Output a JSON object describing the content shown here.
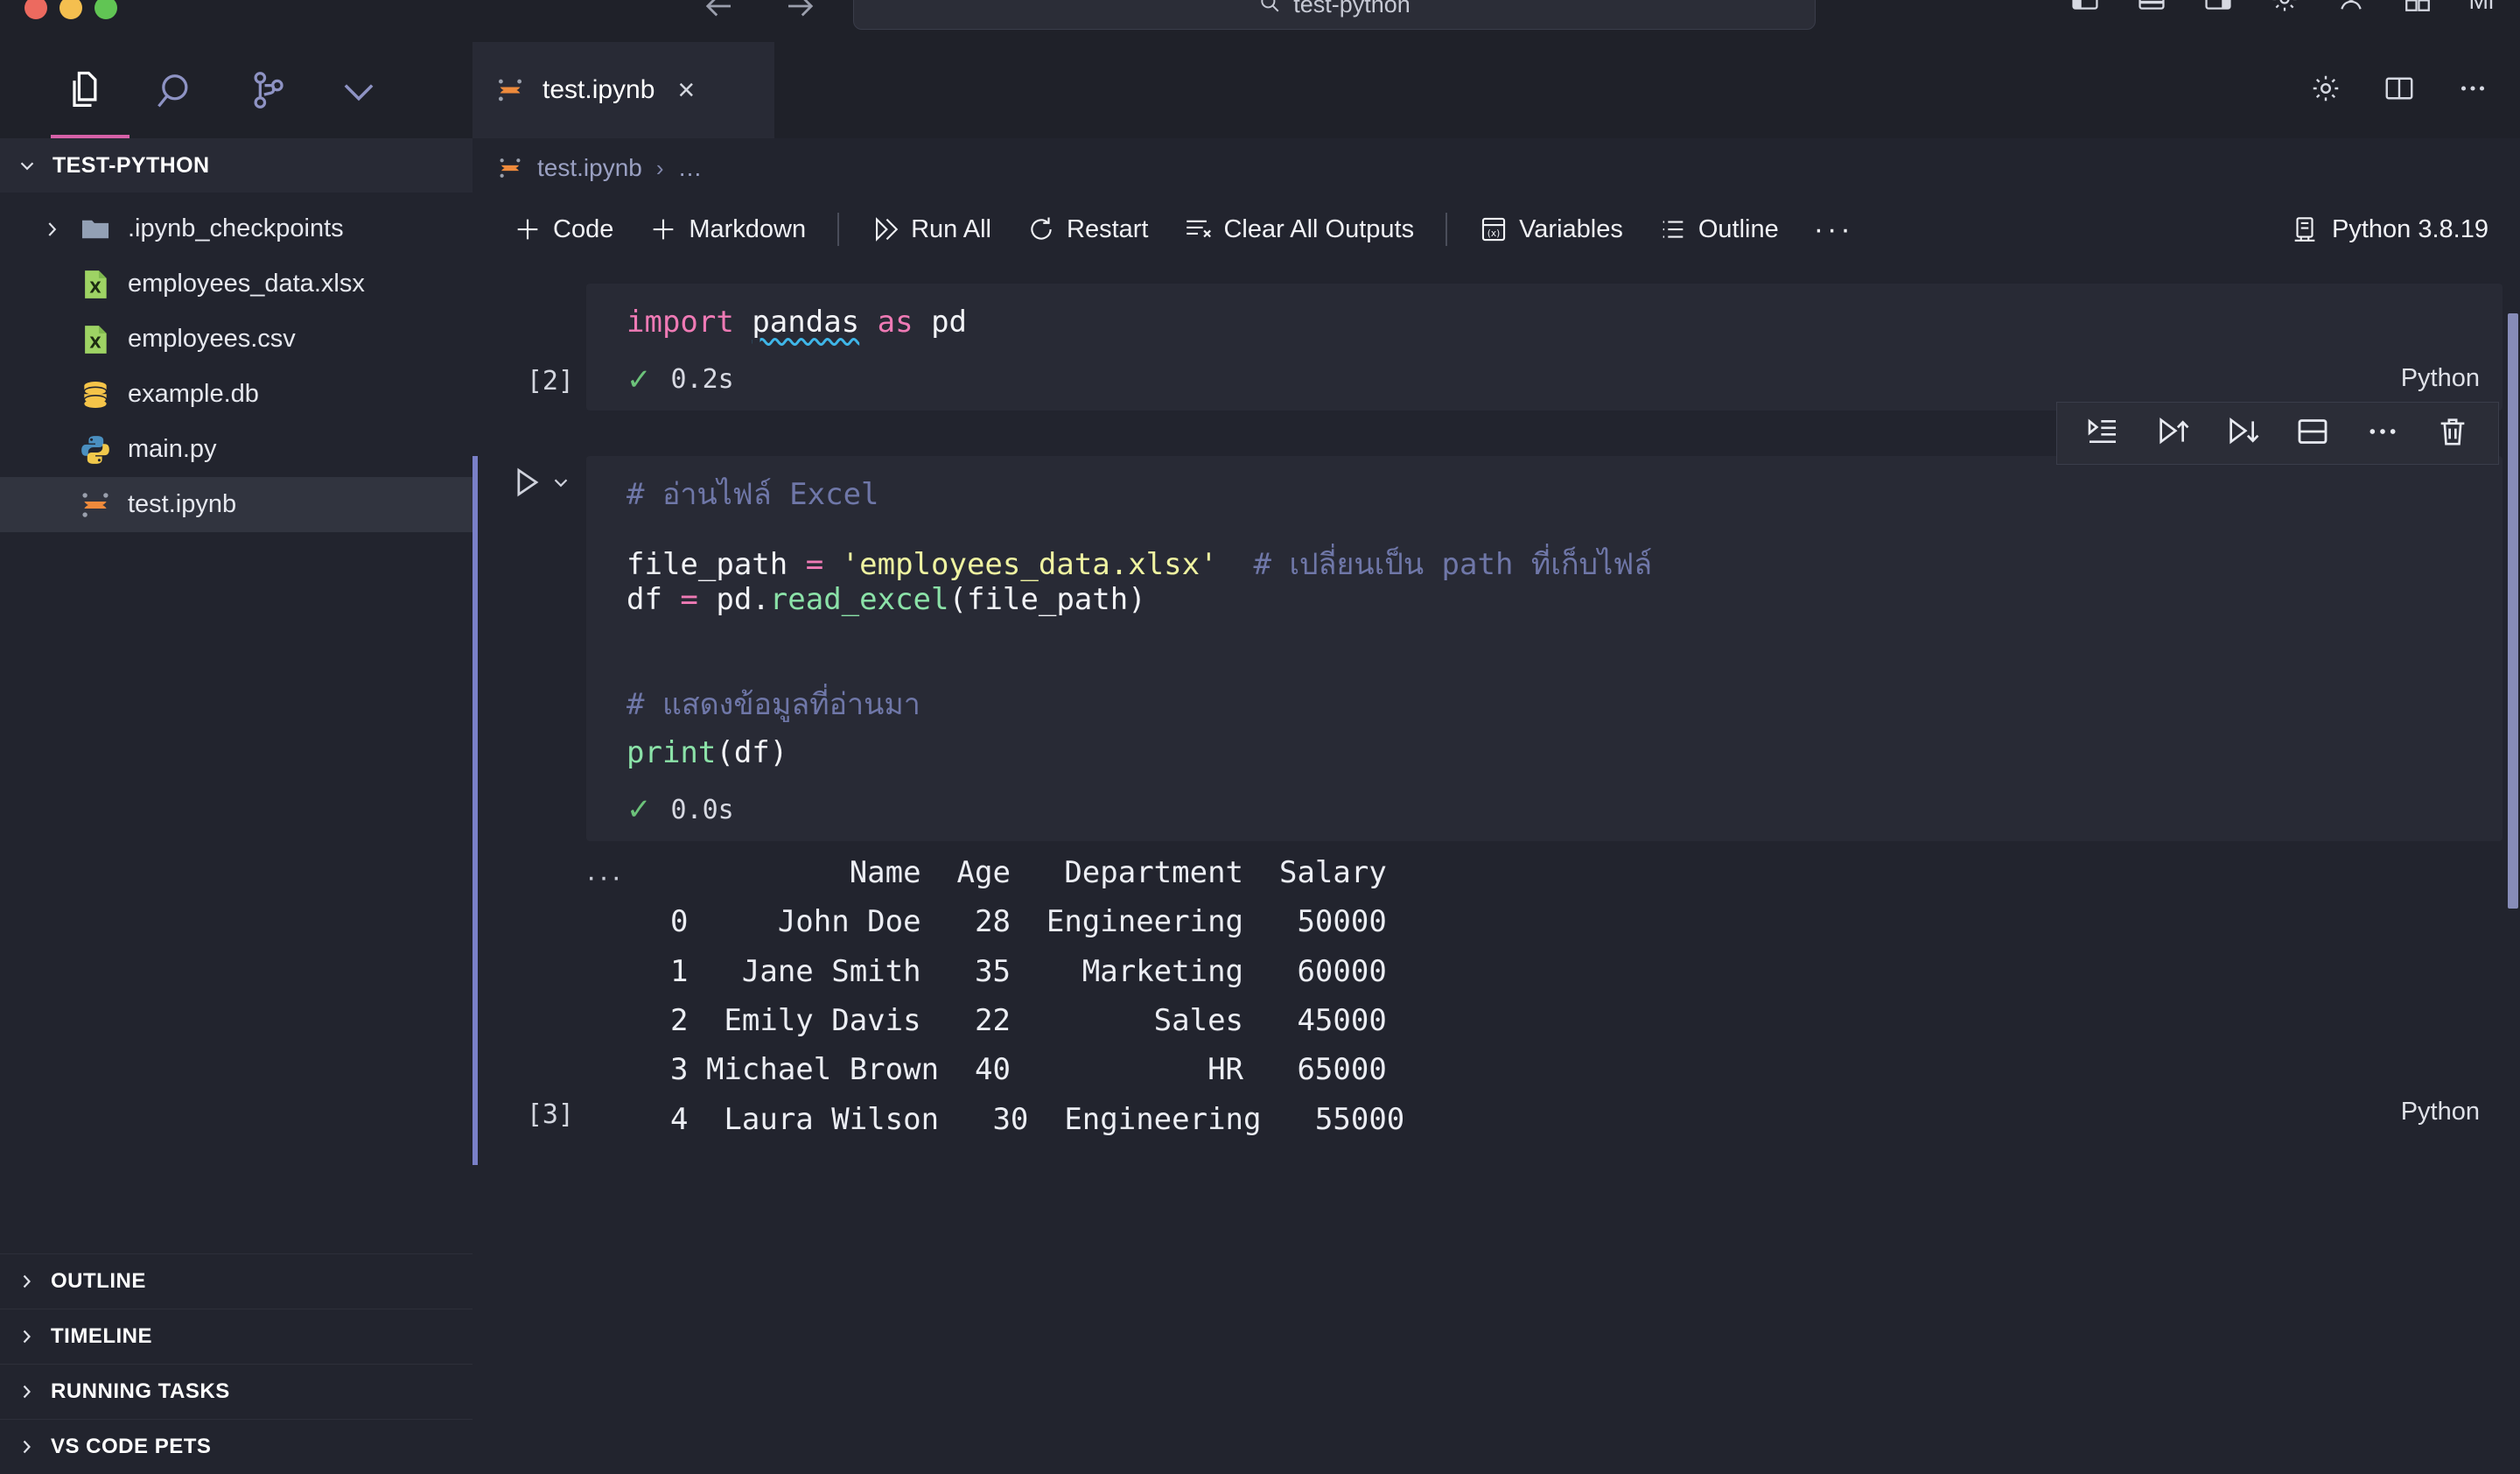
{
  "titlebar": {
    "quickopen_text": "test-python",
    "quickopen_icon": "search-icon",
    "back_icon": "arrow-left-icon",
    "forward_icon": "arrow-right-icon",
    "right_icons": [
      "layout-sidebar-left-icon",
      "layout-panel-icon",
      "layout-sidebar-right-icon",
      "gear-icon",
      "account-icon"
    ],
    "right_label": "Mi"
  },
  "activitybar": {
    "items": [
      {
        "name": "explorer-icon",
        "label": "Explorer",
        "active": true
      },
      {
        "name": "search-icon",
        "label": "Search",
        "active": false
      },
      {
        "name": "source-control-icon",
        "label": "Source Control",
        "active": false
      },
      {
        "name": "chevron-down-icon",
        "label": "More Views",
        "active": false
      }
    ]
  },
  "sidebar": {
    "header": {
      "title": "TEST-PYTHON",
      "chevron": "chevron-down-icon"
    },
    "files": [
      {
        "name": ".ipynb_checkpoints",
        "icon": "folder-icon",
        "twisty": "chevron-right-icon",
        "selected": false
      },
      {
        "name": "employees_data.xlsx",
        "icon": "excel-icon",
        "twisty": "",
        "selected": false
      },
      {
        "name": "employees.csv",
        "icon": "excel-icon",
        "twisty": "",
        "selected": false
      },
      {
        "name": "example.db",
        "icon": "database-icon",
        "twisty": "",
        "selected": false
      },
      {
        "name": "main.py",
        "icon": "python-icon",
        "twisty": "",
        "selected": false
      },
      {
        "name": "test.ipynb",
        "icon": "jupyter-icon",
        "twisty": "",
        "selected": true
      }
    ],
    "panels": [
      {
        "label": "OUTLINE",
        "chevron": "chevron-right-icon"
      },
      {
        "label": "TIMELINE",
        "chevron": "chevron-right-icon"
      },
      {
        "label": "RUNNING TASKS",
        "chevron": "chevron-right-icon"
      },
      {
        "label": "VS CODE PETS",
        "chevron": "chevron-right-icon"
      }
    ]
  },
  "editor": {
    "tab": {
      "label": "test.ipynb",
      "icon": "jupyter-icon",
      "close": "×"
    },
    "tab_actions": [
      "gear-icon",
      "split-editor-icon",
      "more-actions-icon"
    ],
    "breadcrumb": {
      "icon": "jupyter-icon",
      "file": "test.ipynb",
      "separator": "›",
      "more": "…"
    },
    "toolbar": {
      "add_code": "Code",
      "add_markdown": "Markdown",
      "run_all": "Run All",
      "restart": "Restart",
      "clear_all_outputs": "Clear All Outputs",
      "variables": "Variables",
      "outline": "Outline",
      "more": "···",
      "kernel": "Python 3.8.19"
    }
  },
  "cells": [
    {
      "exec_count": "[2]",
      "elapsed": "0.2s",
      "status": "✓",
      "language": "Python",
      "active": false,
      "lines": [
        [
          {
            "t": "import",
            "c": "kw"
          },
          {
            "t": " ",
            "c": "id"
          },
          {
            "t": "pandas",
            "c": "sq"
          },
          {
            "t": " ",
            "c": "id"
          },
          {
            "t": "as",
            "c": "kw"
          },
          {
            "t": " pd",
            "c": "id"
          }
        ]
      ]
    },
    {
      "exec_count": "[3]",
      "elapsed": "0.0s",
      "status": "✓",
      "language": "Python",
      "active": true,
      "lines": [
        [
          {
            "t": "# อ่านไฟล์ Excel",
            "c": "cm"
          }
        ],
        [
          {
            "t": "file_path ",
            "c": "id"
          },
          {
            "t": "=",
            "c": "op"
          },
          {
            "t": " ",
            "c": "id"
          },
          {
            "t": "'employees_data.xlsx'",
            "c": "str"
          },
          {
            "t": "  ",
            "c": "id"
          },
          {
            "t": "# เปลี่ยนเป็น path ที่เก็บไฟล์",
            "c": "cm"
          }
        ],
        [
          {
            "t": "df ",
            "c": "id"
          },
          {
            "t": "=",
            "c": "op"
          },
          {
            "t": " pd.",
            "c": "id"
          },
          {
            "t": "read_excel",
            "c": "fn"
          },
          {
            "t": "(file_path)",
            "c": "id"
          }
        ],
        [],
        [
          {
            "t": "# แสดงข้อมูลที่อ่านมา",
            "c": "cm"
          }
        ],
        [
          {
            "t": "print",
            "c": "fn"
          },
          {
            "t": "(df)",
            "c": "id"
          }
        ]
      ]
    }
  ],
  "hover_toolbar": {
    "icons": [
      "run-by-line-icon",
      "run-above-icon",
      "run-below-icon",
      "split-cell-icon",
      "more-actions-icon",
      "delete-cell-icon"
    ]
  },
  "output": {
    "gutter": "···",
    "text": "          Name  Age   Department  Salary\n0     John Doe   28  Engineering   50000\n1   Jane Smith   35    Marketing   60000\n2  Emily Davis   22        Sales   45000\n3  Michael Brown  40           HR   65000\n4  Laura Wilson   30  Engineering   55000",
    "table": {
      "columns": [
        "",
        "Name",
        "Age",
        "Department",
        "Salary"
      ],
      "rows": [
        [
          "0",
          "John Doe",
          "28",
          "Engineering",
          "50000"
        ],
        [
          "1",
          "Jane Smith",
          "35",
          "Marketing",
          "60000"
        ],
        [
          "2",
          "Emily Davis",
          "22",
          "Sales",
          "45000"
        ],
        [
          "3",
          "Michael Brown",
          "40",
          "HR",
          "65000"
        ],
        [
          "4",
          "Laura Wilson",
          "30",
          "Engineering",
          "55000"
        ]
      ]
    }
  },
  "colors": {
    "bg": "#22242e",
    "cell_bg": "#282a35",
    "accent_pink": "#d661a8",
    "accent_blue": "#7a80c8",
    "keyword": "#ef7ab5",
    "string": "#eff3a1",
    "comment": "#6f77a8",
    "function": "#8be2a8",
    "success": "#6cc27a"
  }
}
